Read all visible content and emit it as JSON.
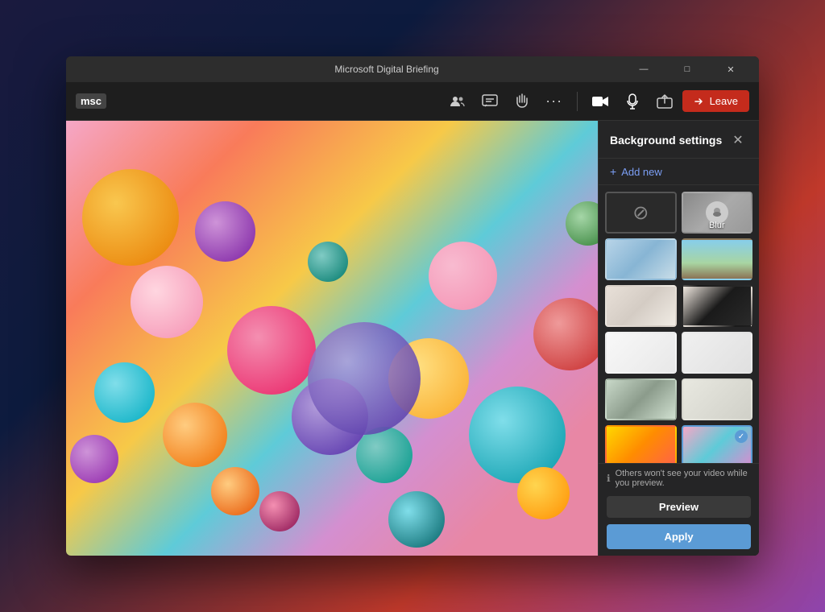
{
  "window": {
    "title": "Microsoft Digital Briefing",
    "controls": {
      "minimize": "—",
      "maximize": "□",
      "close": "✕"
    }
  },
  "toolbar": {
    "logo": "msc",
    "icons": {
      "participants": "👥",
      "chat": "💬",
      "raise_hand": "✋",
      "more": "···"
    },
    "media_controls": {
      "video": "📹",
      "mic": "🎤",
      "share": "↑"
    },
    "leave_button": "Leave"
  },
  "background_settings": {
    "title": "Background settings",
    "add_new_label": "+ Add new",
    "info_text": "Others won't see your video while you preview.",
    "preview_button": "Preview",
    "apply_button": "Apply",
    "thumbnails": [
      {
        "id": "none",
        "label": "",
        "type": "none",
        "selected": false
      },
      {
        "id": "blur",
        "label": "Blur",
        "type": "blur",
        "selected": false
      },
      {
        "id": "office1",
        "label": "",
        "type": "office1",
        "selected": false
      },
      {
        "id": "outdoor",
        "label": "",
        "type": "outdoor",
        "selected": false
      },
      {
        "id": "room1",
        "label": "",
        "type": "room1",
        "selected": false
      },
      {
        "id": "art",
        "label": "",
        "type": "art",
        "selected": false
      },
      {
        "id": "white1",
        "label": "",
        "type": "white1",
        "selected": false
      },
      {
        "id": "white2",
        "label": "",
        "type": "white2",
        "selected": false
      },
      {
        "id": "loft",
        "label": "",
        "type": "loft",
        "selected": false
      },
      {
        "id": "minimal",
        "label": "",
        "type": "minimal",
        "selected": false
      },
      {
        "id": "yellow",
        "label": "",
        "type": "yellow",
        "selected": false
      },
      {
        "id": "balls",
        "label": "",
        "type": "balls",
        "selected": true
      }
    ]
  }
}
